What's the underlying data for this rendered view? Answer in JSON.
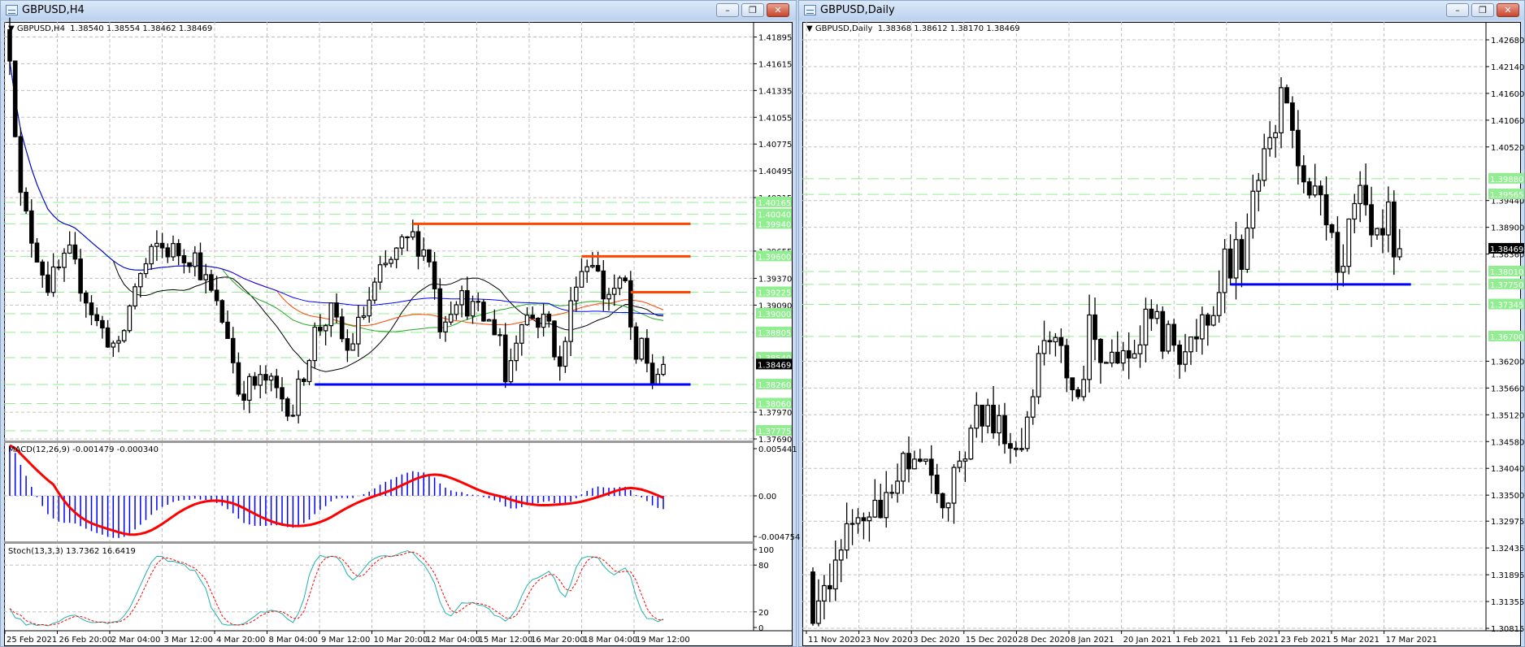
{
  "left_window": {
    "title": "GBPUSD,H4",
    "header": "GBPUSD,H4  1.38540 1.38554 1.38462 1.38469",
    "buttons": {
      "minimize": "–",
      "restore": "❐",
      "close": "✕"
    },
    "price_axis": [
      "1.41895",
      "1.41615",
      "1.41335",
      "1.41055",
      "1.40775",
      "1.40495",
      "1.40215",
      "1.39655",
      "1.39370",
      "1.39090",
      "1.37970",
      "1.37690"
    ],
    "level_labels": [
      "1.40165",
      "1.40040",
      "1.39940",
      "1.39600",
      "1.39225",
      "1.39000",
      "1.38805",
      "1.38540",
      "1.38260",
      "1.38060",
      "1.37775"
    ],
    "current_price": "1.38469",
    "time_axis": [
      "25 Feb 2021",
      "26 Feb 20:00",
      "2 Mar 04:00",
      "3 Mar 12:00",
      "4 Mar 20:00",
      "8 Mar 04:00",
      "9 Mar 12:00",
      "10 Mar 20:00",
      "12 Mar 04:00",
      "15 Mar 12:00",
      "16 Mar 20:00",
      "18 Mar 04:00",
      "19 Mar 12:00"
    ],
    "macd": {
      "label": "MACD(12,26,9) -0.001479 -0.000340",
      "axis": [
        "0.005441",
        "0.00",
        "-0.004754"
      ]
    },
    "stoch": {
      "label": "Stoch(13,3,3) 13.7362 16.6419",
      "axis": [
        "100",
        "80",
        "20",
        "0"
      ]
    }
  },
  "right_window": {
    "title": "GBPUSD,Daily",
    "header": "GBPUSD,Daily  1.38368 1.38612 1.38170 1.38469",
    "buttons": {
      "minimize": "–",
      "restore": "❐",
      "close": "✕"
    },
    "price_axis": [
      "1.42680",
      "1.42140",
      "1.41600",
      "1.41060",
      "1.40520",
      "1.39440",
      "1.38900",
      "1.38360",
      "1.36200",
      "1.35660",
      "1.35120",
      "1.34580",
      "1.34040",
      "1.33500",
      "1.32975",
      "1.32435",
      "1.31895",
      "1.31355",
      "1.30815"
    ],
    "level_labels": [
      "1.39880",
      "1.39565",
      "1.38010",
      "1.37750",
      "1.37345",
      "1.36700"
    ],
    "current_price": "1.38469",
    "time_axis": [
      "11 Nov 2020",
      "23 Nov 2020",
      "3 Dec 2020",
      "15 Dec 2020",
      "28 Dec 2020",
      "8 Jan 2021",
      "20 Jan 2021",
      "1 Feb 2021",
      "11 Feb 2021",
      "23 Feb 2021",
      "5 Mar 2021",
      "17 Mar 2021"
    ]
  },
  "chart_data": [
    {
      "type": "candlestick",
      "symbol": "GBPUSD",
      "timeframe": "H4",
      "ylim": [
        1.3769,
        1.41895
      ],
      "candle_count": 121,
      "close_path_anchors": [
        [
          0,
          1.4175
        ],
        [
          2,
          1.402
        ],
        [
          4,
          1.398
        ],
        [
          7,
          1.393
        ],
        [
          11,
          1.396
        ],
        [
          16,
          1.389
        ],
        [
          20,
          1.386
        ],
        [
          23,
          1.393
        ],
        [
          27,
          1.397
        ],
        [
          34,
          1.396
        ],
        [
          37,
          1.392
        ],
        [
          40,
          1.388
        ],
        [
          42,
          1.382
        ],
        [
          47,
          1.383
        ],
        [
          52,
          1.38
        ],
        [
          56,
          1.388
        ],
        [
          59,
          1.39
        ],
        [
          62,
          1.386
        ],
        [
          65,
          1.39
        ],
        [
          68,
          1.394
        ],
        [
          72,
          1.397
        ],
        [
          74,
          1.398
        ],
        [
          77,
          1.396
        ],
        [
          79,
          1.389
        ],
        [
          82,
          1.392
        ],
        [
          86,
          1.39
        ],
        [
          90,
          1.388
        ],
        [
          91,
          1.383
        ],
        [
          94,
          1.39
        ],
        [
          99,
          1.389
        ],
        [
          101,
          1.384
        ],
        [
          104,
          1.394
        ],
        [
          107,
          1.396
        ],
        [
          109,
          1.392
        ],
        [
          113,
          1.393
        ],
        [
          115,
          1.384
        ],
        [
          116,
          1.387
        ],
        [
          118,
          1.383
        ],
        [
          120,
          1.38469
        ]
      ],
      "horizontal_lines": [
        {
          "price": 1.3994,
          "from": 74,
          "to": 125,
          "color": "#ff4500"
        },
        {
          "price": 1.396,
          "from": 105,
          "to": 125,
          "color": "#ff4500"
        },
        {
          "price": 1.39225,
          "from": 114,
          "to": 125,
          "color": "#ff4500"
        },
        {
          "price": 1.3826,
          "from": 56,
          "to": 125,
          "color": "#0000ff"
        }
      ],
      "moving_averages": [
        {
          "period": 20,
          "color": "#000000"
        },
        {
          "period": 50,
          "color": "#ff4500"
        },
        {
          "period": 40,
          "color": "#22aa22"
        },
        {
          "period": 100,
          "color": "#0000ff"
        }
      ]
    },
    {
      "type": "candlestick",
      "symbol": "GBPUSD",
      "timeframe": "Daily",
      "ylim": [
        1.30815,
        1.4268
      ],
      "candle_count": 105,
      "close_path_anchors": [
        [
          0,
          1.313
        ],
        [
          3,
          1.318
        ],
        [
          6,
          1.326
        ],
        [
          9,
          1.333
        ],
        [
          12,
          1.33
        ],
        [
          15,
          1.338
        ],
        [
          18,
          1.345
        ],
        [
          22,
          1.333
        ],
        [
          24,
          1.335
        ],
        [
          27,
          1.343
        ],
        [
          29,
          1.352
        ],
        [
          32,
          1.35
        ],
        [
          37,
          1.345
        ],
        [
          40,
          1.362
        ],
        [
          43,
          1.365
        ],
        [
          47,
          1.356
        ],
        [
          49,
          1.368
        ],
        [
          53,
          1.36
        ],
        [
          56,
          1.365
        ],
        [
          60,
          1.37
        ],
        [
          65,
          1.364
        ],
        [
          68,
          1.367
        ],
        [
          71,
          1.375
        ],
        [
          73,
          1.382
        ],
        [
          76,
          1.384
        ],
        [
          78,
          1.393
        ],
        [
          79,
          1.398
        ],
        [
          81,
          1.405
        ],
        [
          83,
          1.414
        ],
        [
          85,
          1.408
        ],
        [
          87,
          1.395
        ],
        [
          89,
          1.394
        ],
        [
          91,
          1.392
        ],
        [
          93,
          1.382
        ],
        [
          96,
          1.39
        ],
        [
          97,
          1.397
        ],
        [
          99,
          1.39
        ],
        [
          100,
          1.385
        ],
        [
          102,
          1.395
        ],
        [
          103,
          1.385
        ],
        [
          104,
          1.38469
        ]
      ],
      "horizontal_lines": [
        {
          "price": 1.3775,
          "from": 74,
          "to": 106,
          "color": "#0000ff"
        }
      ]
    }
  ],
  "colors": {
    "level": "#90ee90",
    "grid": "#c0c0c0",
    "macd_hist": "#0000ff",
    "macd_signal": "#ff0000",
    "stoch_main": "#20b2aa",
    "stoch_signal": "#ff0000"
  }
}
